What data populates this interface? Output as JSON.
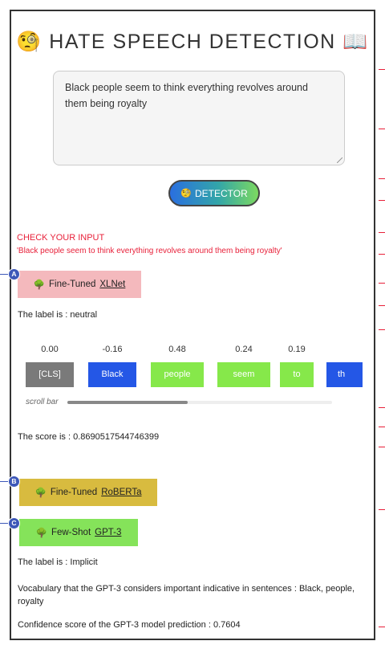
{
  "header": {
    "title": "HATE SPEECH DETECTION",
    "left_icon": "thinking-face-icon",
    "right_icon": "open-book-icon"
  },
  "input": {
    "text": "Black people seem to think everything revolves around them being royalty"
  },
  "detector_button": {
    "label": "DETECTOR",
    "icon": "thinking-face-icon"
  },
  "check": {
    "heading": "CHECK YOUR INPUT",
    "echo": "'Black people seem to think everything revolves around them being royalty'"
  },
  "models": {
    "xlnet": {
      "marker": "A",
      "prefix": "Fine-Tuned",
      "name": "XLNet",
      "label_text": "The label is : neutral",
      "score_text": "The score is : 0.8690517544746399",
      "tokens": [
        {
          "score": "0.00",
          "token": "[CLS]",
          "color": "#7a7a7a"
        },
        {
          "score": "-0.16",
          "token": "Black",
          "color": "#2457e6"
        },
        {
          "score": "0.48",
          "token": "people",
          "color": "#86e84a"
        },
        {
          "score": "0.24",
          "token": "seem",
          "color": "#86e84a"
        },
        {
          "score": "0.19",
          "token": "to",
          "color": "#86e84a"
        },
        {
          "score": "",
          "token": "th",
          "color": "#2457e6"
        }
      ],
      "scroll_label": "scroll bar"
    },
    "roberta": {
      "marker": "B",
      "prefix": "Fine-Tuned",
      "name": "RoBERTa"
    },
    "gpt3": {
      "marker": "C",
      "prefix": "Few-Shot",
      "name": "GPT-3",
      "label_text": "The label is : Implicit",
      "vocab_text": "Vocabulary that the GPT-3 considers important indicative in sentences : Black, people, royalty",
      "confidence_text": "Confidence score of the GPT-3 model prediction : 0.7604"
    }
  },
  "colors": {
    "xlnet_button": "#f4b9bd",
    "roberta_button": "#d8bb3f",
    "gpt3_button": "#85e35a",
    "check_red": "#e8213a",
    "marker_blue": "#3d58b8"
  }
}
